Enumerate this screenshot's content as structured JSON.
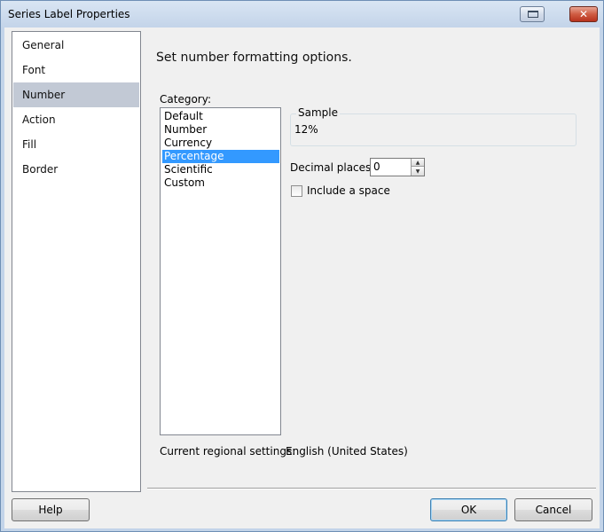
{
  "window": {
    "title": "Series Label Properties",
    "close_glyph": "✕"
  },
  "nav": {
    "items": [
      {
        "label": "General"
      },
      {
        "label": "Font"
      },
      {
        "label": "Number"
      },
      {
        "label": "Action"
      },
      {
        "label": "Fill"
      },
      {
        "label": "Border"
      }
    ],
    "selected": "Number"
  },
  "main": {
    "heading": "Set number formatting options.",
    "category_label": "Category:",
    "categories": [
      "Default",
      "Number",
      "Currency",
      "Percentage",
      "Scientific",
      "Custom"
    ],
    "selected_category": "Percentage",
    "sample": {
      "label": "Sample",
      "value": "12%"
    },
    "decimal_places": {
      "label": "Decimal places:",
      "value": "0"
    },
    "include_space": {
      "label": "Include a space",
      "checked": false
    },
    "regional": {
      "label": "Current regional settings:",
      "value": "English (United States)"
    }
  },
  "buttons": {
    "help": "Help",
    "ok": "OK",
    "cancel": "Cancel"
  },
  "colors": {
    "selection": "#3399ff",
    "nav_selection": "#c2c9d5"
  }
}
